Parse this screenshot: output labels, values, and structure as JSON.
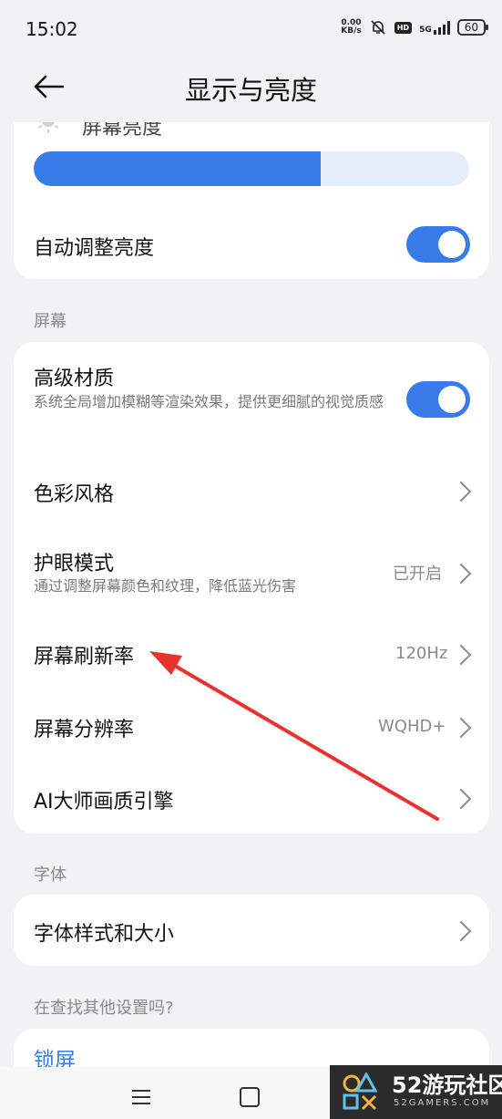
{
  "status": {
    "time": "15:02",
    "speed_value": "0.00",
    "speed_unit": "KB/s",
    "hd": "HD",
    "network": "5G",
    "battery": "60"
  },
  "header": {
    "title": "显示与亮度"
  },
  "brightness": {
    "label": "屏幕亮度",
    "level": 0.66,
    "auto_label": "自动调整亮度",
    "auto_on": true
  },
  "screen_section": {
    "label": "屏幕",
    "items": [
      {
        "label": "高级材质",
        "sub": "系统全局增加模糊等渲染效果，提供更细腻的视觉质感",
        "toggle": true
      },
      {
        "label": "色彩风格"
      },
      {
        "label": "护眼模式",
        "sub": "通过调整屏幕颜色和纹理，降低蓝光伤害",
        "value": "已开启"
      },
      {
        "label": "屏幕刷新率",
        "value": "120Hz"
      },
      {
        "label": "屏幕分辨率",
        "value": "WQHD+"
      },
      {
        "label": "AI大师画质引擎"
      }
    ]
  },
  "font_section": {
    "label": "字体",
    "items": [
      {
        "label": "字体样式和大小"
      }
    ]
  },
  "more": {
    "label": "在查找其他设置吗?",
    "lock_link": "锁屏"
  },
  "watermark": {
    "brand_number": "52",
    "brand_name": "游玩社区",
    "brand_url": "52GAMERS.COM"
  },
  "colors": {
    "accent": "#3a7bea",
    "arrow": "#e8322d",
    "background": "#f2f2f4"
  }
}
